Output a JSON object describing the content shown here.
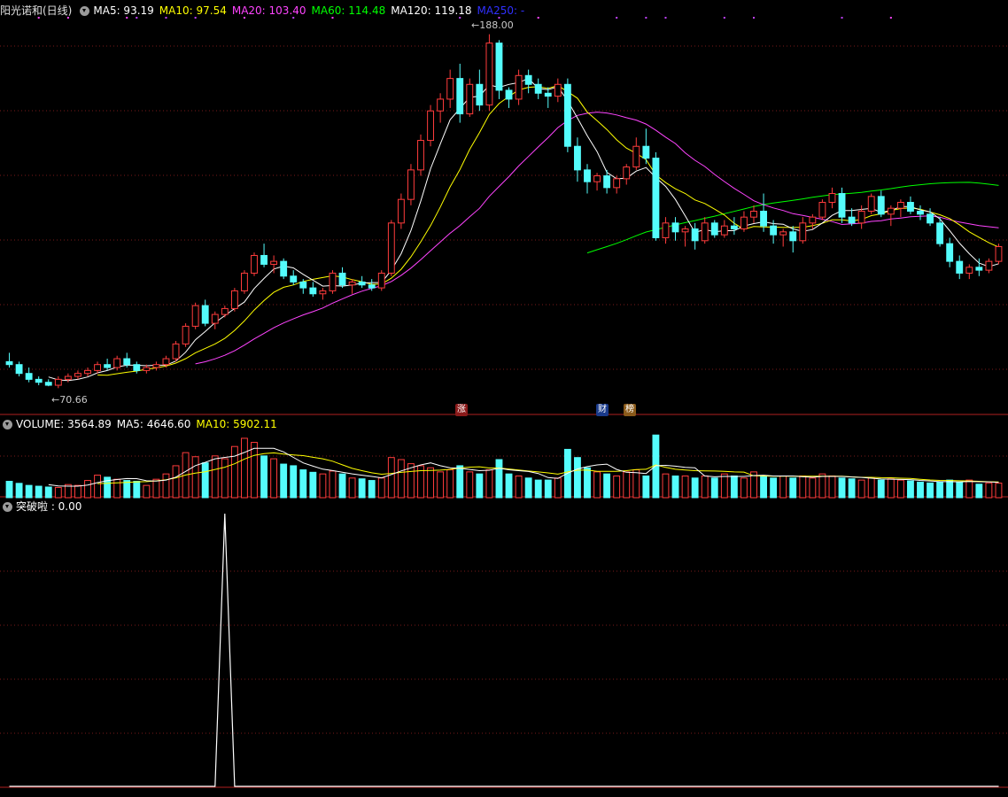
{
  "main_header": {
    "title": "阳光诺和(日线)",
    "ma": [
      {
        "label": "MA5: 93.19",
        "color": "#ffffff"
      },
      {
        "label": "MA10: 97.54",
        "color": "#ffff00"
      },
      {
        "label": "MA20: 103.40",
        "color": "#ff44ff"
      },
      {
        "label": "MA60: 114.48",
        "color": "#00ff00"
      },
      {
        "label": "MA120: 119.18",
        "color": "#ffffff"
      },
      {
        "label": "MA250: -",
        "color": "#3030ff"
      }
    ]
  },
  "volume_header": {
    "items": [
      {
        "label": "VOLUME: 3564.89",
        "color": "#ffffff"
      },
      {
        "label": "MA5: 4646.60",
        "color": "#ffffff"
      },
      {
        "label": "MA10: 5902.11",
        "color": "#ffff00"
      }
    ]
  },
  "indicator_header": {
    "items": [
      {
        "label": "突破啦 : 0.00",
        "color": "#ffffff"
      }
    ]
  },
  "annotations": {
    "high": "188.00",
    "low": "70.66"
  },
  "badges": [
    {
      "text": "涨",
      "bg": "#8a1a1a",
      "fg": "#ffffff"
    },
    {
      "text": "财",
      "bg": "#1a3a8a",
      "fg": "#ffffff"
    },
    {
      "text": "榜",
      "bg": "#8a5a1a",
      "fg": "#ffffff"
    }
  ],
  "colors": {
    "up": "#ff3c3c",
    "down": "#54fcfc",
    "grid": "#7a1a1a",
    "ma5": "#ffffff",
    "ma10": "#ffff00",
    "ma20": "#ff44ff",
    "ma60": "#00ff00",
    "signal": "#ffffff"
  },
  "chart_data": {
    "type": "candlestick",
    "price_range": [
      62,
      195
    ],
    "candles": [
      [
        79,
        82,
        77,
        78
      ],
      [
        78,
        79,
        74,
        75
      ],
      [
        75,
        77,
        72,
        73
      ],
      [
        73,
        74,
        71,
        72
      ],
      [
        72,
        73,
        70.66,
        71
      ],
      [
        71,
        74,
        70,
        73
      ],
      [
        73,
        75,
        72,
        74
      ],
      [
        74,
        76,
        73,
        75
      ],
      [
        75,
        77,
        74,
        76
      ],
      [
        76,
        79,
        75,
        78
      ],
      [
        78,
        80,
        76,
        77
      ],
      [
        77,
        81,
        76,
        80
      ],
      [
        80,
        82,
        77,
        78
      ],
      [
        78,
        79,
        75,
        76
      ],
      [
        76,
        78,
        75,
        77
      ],
      [
        77,
        79,
        76,
        78
      ],
      [
        78,
        81,
        77,
        80
      ],
      [
        80,
        86,
        79,
        85
      ],
      [
        85,
        92,
        84,
        91
      ],
      [
        91,
        99,
        90,
        98
      ],
      [
        98,
        100,
        91,
        92
      ],
      [
        92,
        96,
        90,
        95
      ],
      [
        95,
        98,
        94,
        97
      ],
      [
        97,
        104,
        96,
        103
      ],
      [
        103,
        110,
        102,
        109
      ],
      [
        109,
        116,
        108,
        115
      ],
      [
        115,
        119,
        111,
        112
      ],
      [
        112,
        115,
        109,
        113
      ],
      [
        113,
        114,
        107,
        108
      ],
      [
        108,
        110,
        105,
        106
      ],
      [
        106,
        107,
        102,
        104
      ],
      [
        104,
        106,
        101,
        102
      ],
      [
        102,
        104,
        100,
        103
      ],
      [
        103,
        110,
        102,
        109
      ],
      [
        109,
        111,
        104,
        105
      ],
      [
        105,
        107,
        102,
        106
      ],
      [
        106,
        108,
        104,
        105
      ],
      [
        105,
        107,
        103,
        104
      ],
      [
        104,
        110,
        103,
        109
      ],
      [
        109,
        127,
        108,
        126
      ],
      [
        126,
        136,
        124,
        134
      ],
      [
        134,
        146,
        132,
        144
      ],
      [
        144,
        156,
        142,
        154
      ],
      [
        154,
        166,
        152,
        164
      ],
      [
        164,
        170,
        160,
        168
      ],
      [
        168,
        178,
        165,
        175
      ],
      [
        175,
        180,
        160,
        163
      ],
      [
        163,
        175,
        162,
        173
      ],
      [
        173,
        178,
        164,
        166
      ],
      [
        166,
        190,
        164,
        187
      ],
      [
        187,
        188,
        168,
        171
      ],
      [
        171,
        172,
        165,
        168
      ],
      [
        168,
        178,
        166,
        176
      ],
      [
        176,
        178,
        170,
        173
      ],
      [
        173,
        175,
        168,
        170
      ],
      [
        170,
        172,
        165,
        169
      ],
      [
        169,
        175,
        167,
        173
      ],
      [
        173,
        175,
        150,
        152
      ],
      [
        152,
        155,
        140,
        144
      ],
      [
        144,
        146,
        136,
        140
      ],
      [
        140,
        143,
        137,
        142
      ],
      [
        142,
        144,
        136,
        138
      ],
      [
        138,
        142,
        136,
        141
      ],
      [
        141,
        146,
        139,
        145
      ],
      [
        145,
        155,
        144,
        152
      ],
      [
        152,
        158,
        146,
        148
      ],
      [
        148,
        150,
        120,
        121
      ],
      [
        121,
        128,
        119,
        126
      ],
      [
        126,
        128,
        120,
        123
      ],
      [
        123,
        125,
        118,
        124
      ],
      [
        124,
        126,
        117,
        120
      ],
      [
        120,
        128,
        119,
        126
      ],
      [
        126,
        127,
        121,
        122
      ],
      [
        122,
        127,
        121,
        125
      ],
      [
        125,
        128,
        122,
        124
      ],
      [
        124,
        130,
        123,
        128
      ],
      [
        128,
        132,
        126,
        130
      ],
      [
        130,
        136,
        123,
        125
      ],
      [
        125,
        127,
        119,
        122
      ],
      [
        122,
        124,
        118,
        123
      ],
      [
        123,
        125,
        116,
        120
      ],
      [
        120,
        128,
        119,
        126
      ],
      [
        126,
        129,
        124,
        128
      ],
      [
        128,
        134,
        127,
        133
      ],
      [
        133,
        138,
        131,
        136
      ],
      [
        136,
        138,
        126,
        128
      ],
      [
        128,
        131,
        125,
        126
      ],
      [
        126,
        132,
        124,
        130
      ],
      [
        130,
        136,
        129,
        135
      ],
      [
        135,
        137,
        128,
        129
      ],
      [
        129,
        132,
        125,
        131
      ],
      [
        131,
        134,
        128,
        133
      ],
      [
        133,
        135,
        129,
        130
      ],
      [
        130,
        132,
        127,
        129
      ],
      [
        129,
        131,
        125,
        126
      ],
      [
        126,
        128,
        118,
        119
      ],
      [
        119,
        121,
        111,
        113
      ],
      [
        113,
        115,
        107,
        109
      ],
      [
        109,
        112,
        107,
        111
      ],
      [
        111,
        114,
        108,
        110
      ],
      [
        110,
        114,
        109,
        113
      ],
      [
        113,
        119,
        112,
        118
      ]
    ],
    "volume_range": [
      0,
      16000
    ],
    "volume": [
      4000,
      3500,
      3000,
      2800,
      2600,
      2500,
      3200,
      3000,
      4200,
      5500,
      5000,
      4500,
      4200,
      4000,
      3000,
      4500,
      5800,
      7800,
      11000,
      10000,
      8500,
      10200,
      9500,
      12500,
      14500,
      13500,
      10200,
      9500,
      8200,
      7800,
      6800,
      6200,
      5800,
      6500,
      5800,
      4800,
      4600,
      4200,
      4800,
      9800,
      9300,
      8300,
      7800,
      7300,
      6300,
      6800,
      7800,
      6300,
      5800,
      6800,
      9300,
      5800,
      5300,
      4800,
      4300,
      4300,
      4800,
      11800,
      9800,
      7300,
      6300,
      5800,
      5300,
      6300,
      6800,
      5300,
      15300,
      5800,
      5300,
      5300,
      4800,
      5300,
      4800,
      5800,
      5300,
      4800,
      6300,
      5300,
      4800,
      5300,
      4800,
      5300,
      4800,
      5800,
      5300,
      4800,
      4600,
      4300,
      4800,
      4300,
      4600,
      4300,
      4100,
      3800,
      3600,
      3800,
      4300,
      3800,
      4300,
      3300,
      3600,
      3564.89
    ],
    "signal_range": [
      0,
      1
    ],
    "signal_index": 22,
    "signal_peak_value": 1
  }
}
